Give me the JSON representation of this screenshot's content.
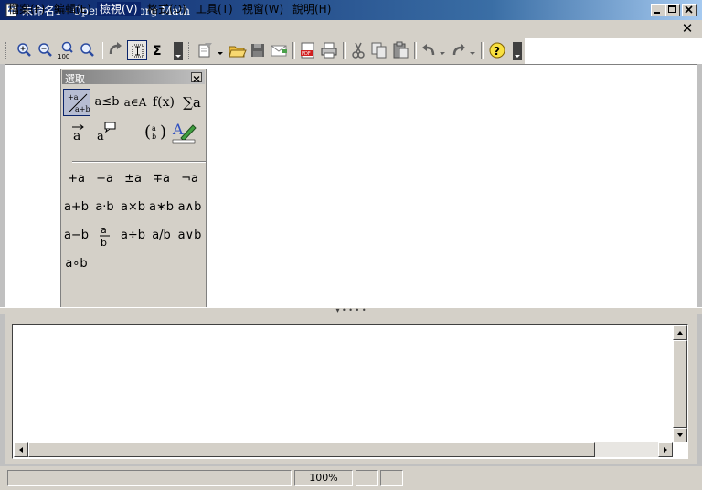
{
  "window": {
    "title": "未命名1 - OpenOffice.org Math"
  },
  "menu": {
    "items": [
      "檔案(F)",
      "編輯(E)",
      "檢視(V)",
      "格式(O)",
      "工具(T)",
      "視窗(W)",
      "說明(H)"
    ],
    "active_index": 2
  },
  "toolbar": {
    "zoom_100_label": "100"
  },
  "selection_window": {
    "title": "選取",
    "categories": {
      "unary_binary": "+a/a+b",
      "relations": "a≤b",
      "set_ops": "a∈A",
      "functions": "f(x)",
      "operators": "∑a",
      "attributes": "a⃗",
      "others": "a",
      "brackets": "(a/b)",
      "formats": "A"
    },
    "symbols": [
      [
        "+a",
        "−a",
        "±a",
        "∓a",
        "¬a"
      ],
      [
        "a+b",
        "a·b",
        "a×b",
        "a∗b",
        "a∧b"
      ],
      [
        "a−b",
        "a/b_frac",
        "a÷b",
        "a/b",
        "a∨b"
      ],
      [
        "a∘b"
      ]
    ],
    "frac_num": "a",
    "frac_den": "b"
  },
  "status": {
    "zoom": "100%"
  },
  "colors": {
    "title_gradient_start": "#0a246a",
    "menu_active": "#0a246a",
    "face": "#d4d0c8"
  }
}
